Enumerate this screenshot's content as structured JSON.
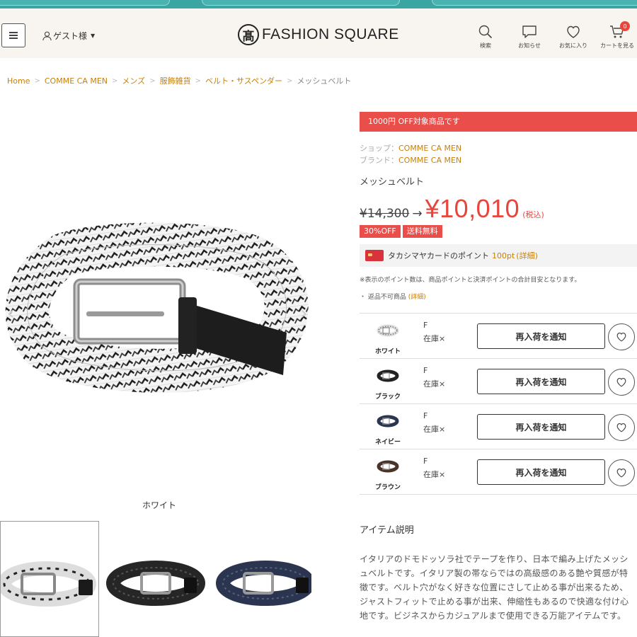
{
  "header": {
    "guest_label": "ゲスト様",
    "logo_mark": "髙",
    "logo_text": "FASHION SQUARE",
    "icons": [
      {
        "name": "search-icon",
        "label": "検索"
      },
      {
        "name": "chat-icon",
        "label": "お知らせ"
      },
      {
        "name": "heart-icon",
        "label": "お気に入り"
      },
      {
        "name": "cart-icon",
        "label": "カートを見る"
      }
    ],
    "cart_count": "0"
  },
  "breadcrumb": {
    "items": [
      "Home",
      "COMME CA MEN",
      "メンズ",
      "服飾雑貨",
      "ベルト・サスペンダー"
    ],
    "current": "メッシュベルト"
  },
  "gallery": {
    "color_caption": "ホワイト",
    "prev_icon": "chevron-left-icon",
    "next_icon": "chevron-right-icon"
  },
  "product": {
    "off_banner": "1000円 OFF対象商品です",
    "shop_label": "ショップ：",
    "shop": "COMME CA MEN",
    "brand_label": "ブランド：",
    "brand": "COMME CA MEN",
    "name": "メッシュベルト",
    "old_price": "¥14,300",
    "arrow": "→",
    "new_price": "¥10,010",
    "tax": "(税込)",
    "tags": [
      "30%OFF",
      "送料無料"
    ],
    "points_text": "タカシマヤカードのポイント",
    "points_value": "100pt",
    "points_detail": "(詳細)",
    "note": "※表示のポイント数は、商品ポイントと決済ポイントの合計目安となります。",
    "nonreturn_bullet": "・",
    "nonreturn": "返品不可商品",
    "nonreturn_detail": "(詳細)"
  },
  "variants": [
    {
      "name": "ホワイト",
      "size": "F",
      "stock": "在庫×",
      "button": "再入荷を通知",
      "color": "#e6e6e6"
    },
    {
      "name": "ブラック",
      "size": "F",
      "stock": "在庫×",
      "button": "再入荷を通知",
      "color": "#222222"
    },
    {
      "name": "ネイビー",
      "size": "F",
      "stock": "在庫×",
      "button": "再入荷を通知",
      "color": "#2b3550"
    },
    {
      "name": "ブラウン",
      "size": "F",
      "stock": "在庫×",
      "button": "再入荷を通知",
      "color": "#4a3328"
    }
  ],
  "description": {
    "title": "アイテム説明",
    "body": "イタリアのドモドッソラ社でテープを作り、日本で編み上げたメッシュベルトです。イタリア製の帯ならではの高級感のある艶や質感が特徴です。ベルト穴がなく好きな位置にさして止める事が出来るため、ジャストフィットで止める事が出来、伸縮性もあるので快適な付け心地です。ビジネスからカジュアルまで使用できる万能アイテムです。"
  },
  "colors": {
    "accent": "#c8800a",
    "sale_red": "#e94e4a",
    "price_red": "#e8453c",
    "topbar": "#3aa6a4"
  }
}
